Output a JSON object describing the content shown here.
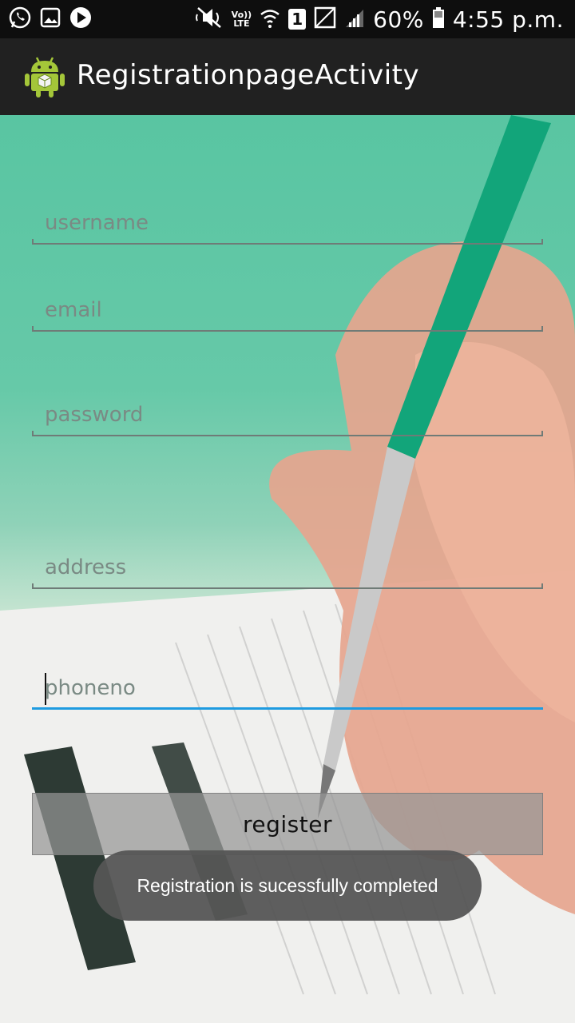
{
  "status_bar": {
    "volte": "Vo))",
    "lte": "LTE",
    "sim": "1",
    "battery": "60%",
    "time": "4:55 p.m."
  },
  "app_bar": {
    "title": "RegistrationpageActivity"
  },
  "form": {
    "username_placeholder": "username",
    "email_placeholder": "email",
    "password_placeholder": "password",
    "address_placeholder": "address",
    "phoneno_placeholder": "phoneno",
    "register_label": "register"
  },
  "toast": {
    "message": "Registration is sucessfully completed"
  },
  "colors": {
    "focus_accent": "#1e9be0",
    "app_bar": "#212121",
    "status_bar": "#0e0e0e"
  }
}
